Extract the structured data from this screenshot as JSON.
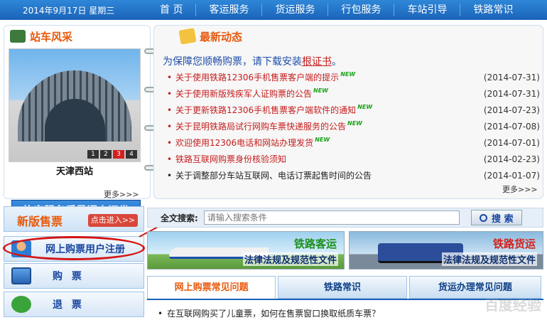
{
  "topbar": {
    "date": "2014年9月17日 星期三",
    "nav": [
      "首 页",
      "客运服务",
      "货运服务",
      "行包服务",
      "车站引导",
      "铁路常识"
    ]
  },
  "station": {
    "title": "站车风采",
    "name": "天津西站",
    "pager": [
      "1",
      "2",
      "3",
      "4"
    ],
    "active_page": "3",
    "more": "更多>>>",
    "survey": "旅客服务质量调查问卷"
  },
  "news": {
    "title": "最新动态",
    "notice_prefix": "为保障您顺畅购票，请下载安装",
    "notice_link": "根证书",
    "notice_suffix": "。",
    "items": [
      {
        "text": "关于使用铁路12306手机售票客户端的提示",
        "new": "NEW",
        "date": "(2014-07-31)"
      },
      {
        "text": "关于使用新版残疾军人证购票的公告",
        "new": "NEW",
        "date": "(2014-07-31)"
      },
      {
        "text": "关于更新铁路12306手机售票客户端软件的通知",
        "new": "NEW",
        "date": "(2014-07-23)"
      },
      {
        "text": "关于昆明铁路局试行网购车票快递服务的公告",
        "new": "NEW",
        "date": "(2014-07-08)"
      },
      {
        "text": "欢迎使用12306电话和网站办理发货",
        "new": "NEW",
        "date": "(2014-07-01)"
      },
      {
        "text": "铁路互联网购票身份核验须知",
        "new": "",
        "date": "(2014-02-23)"
      },
      {
        "text": "关于调整部分车站互联网、电话订票起售时间的公告",
        "new": "",
        "date": "(2014-01-07)"
      }
    ],
    "more": "更多>>>"
  },
  "left": {
    "newver_label": "新版售票",
    "enter_label": "点击进入>>",
    "register": "网上购票用户注册",
    "buy": "购 票",
    "refund": "退 票"
  },
  "search": {
    "label": "全文搜索:",
    "placeholder": "请输入搜索条件",
    "button": "搜 索"
  },
  "banners": {
    "passenger_title": "铁路客运",
    "passenger_sub": "法律法规及规范性文件",
    "freight_title": "铁路货运",
    "freight_sub": "法律法规及规范性文件"
  },
  "tabs": [
    "网上购票常见问题",
    "铁路常识",
    "货运办理常见问题"
  ],
  "faq_first": "在互联网购买了儿童票，如何在售票窗口换取纸质车票？",
  "watermark": "百度经验"
}
